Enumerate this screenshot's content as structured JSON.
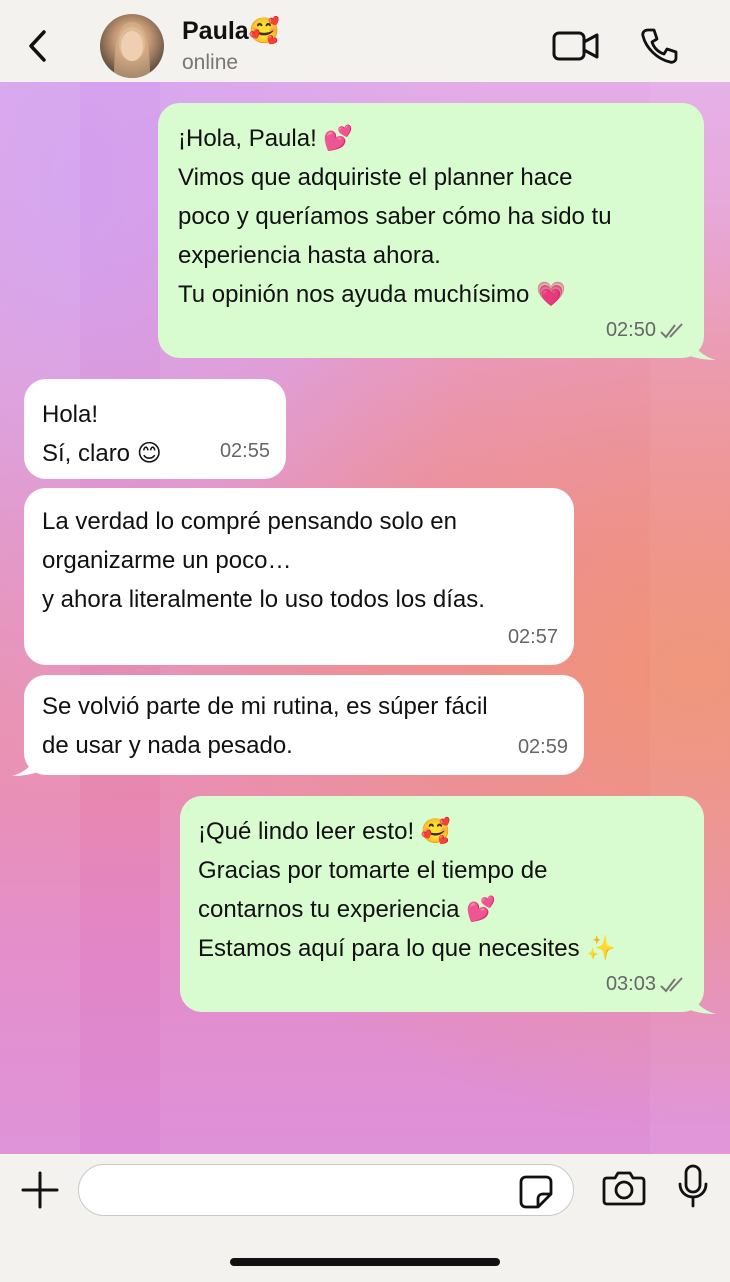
{
  "header": {
    "contact_name": "Paula",
    "contact_emoji": "🥰",
    "status": "online"
  },
  "messages": [
    {
      "direction": "outgoing",
      "text": "¡Hola, Paula!  💕\nVimos que adquiriste el planner hace\npoco y queríamos saber cómo ha sido tu\nexperiencia hasta ahora.\nTu opinión nos ayuda muchísimo  💗",
      "time": "02:50",
      "read": true
    },
    {
      "direction": "incoming",
      "text": "Hola!\nSí, claro  😊",
      "time": "02:55"
    },
    {
      "direction": "incoming",
      "text": "La verdad lo compré pensando solo en\norganizarme un poco…\ny ahora literalmente lo uso todos los días.",
      "time": "02:57"
    },
    {
      "direction": "incoming",
      "text": "Se volvió parte de mi rutina, es súper fácil\nde usar y nada pesado.",
      "time": "02:59"
    },
    {
      "direction": "outgoing",
      "text": "¡Qué lindo leer esto!  🥰\nGracias por tomarte el tiempo de\ncontarnos tu experiencia  💕\nEstamos aquí para lo que necesites  ✨",
      "time": "03:03",
      "read": true
    }
  ],
  "input": {
    "placeholder": ""
  },
  "icons": {
    "back": "chevron-left-icon",
    "video": "video-camera-icon",
    "call": "phone-icon",
    "attach": "plus-icon",
    "sticker": "sticker-icon",
    "camera": "camera-icon",
    "mic": "microphone-icon",
    "read_receipt": "double-check-icon"
  },
  "colors": {
    "outgoing_bubble": "#d8fcd0",
    "incoming_bubble": "#ffffff",
    "bar_background": "#f4f2ee"
  }
}
